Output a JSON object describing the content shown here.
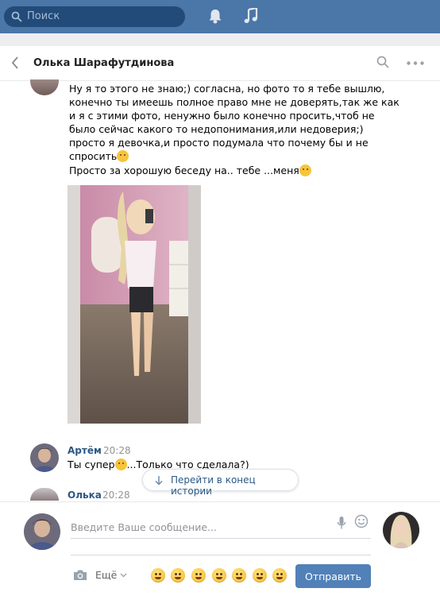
{
  "search": {
    "placeholder": "Поиск"
  },
  "chat": {
    "title": "Олька Шарафутдинова"
  },
  "messages": {
    "olka_text1": "Ну я то этого не знаю;) согласна, но фото то я тебе вышлю, конечно ты имеешь полное право мне не доверять,так же как и я с этими фото, ненужно было конечно просить,чтоб не было сейчас какого то недопонимания,или недоверия;) просто я девочка,и просто подумала что почему бы и не спросить",
    "olka_text2": "Просто за хорошую беседу на.. тебе ...меня",
    "artem_name": "Артём",
    "artem_time": "20:28",
    "artem_text_a": "Ты супер",
    "artem_text_b": "...Только что сделала?)",
    "olka_name": "Олька",
    "olka_time": "20:28"
  },
  "jump_button": {
    "label": "Перейти в конец истории"
  },
  "composer": {
    "placeholder": "Введите Ваше сообщение...",
    "more_label": "Ещё",
    "send_label": "Отправить"
  },
  "icons": [
    "search-icon",
    "bell-icon",
    "music-icon",
    "back-icon",
    "more-icon",
    "microphone-icon",
    "smile-icon",
    "camera-icon",
    "chevron-down-icon",
    "arrow-down-icon"
  ],
  "colors": {
    "header_bar": "#4a76a8",
    "link": "#2a5885",
    "send_button": "#5181b8",
    "background": "#edeef0"
  }
}
